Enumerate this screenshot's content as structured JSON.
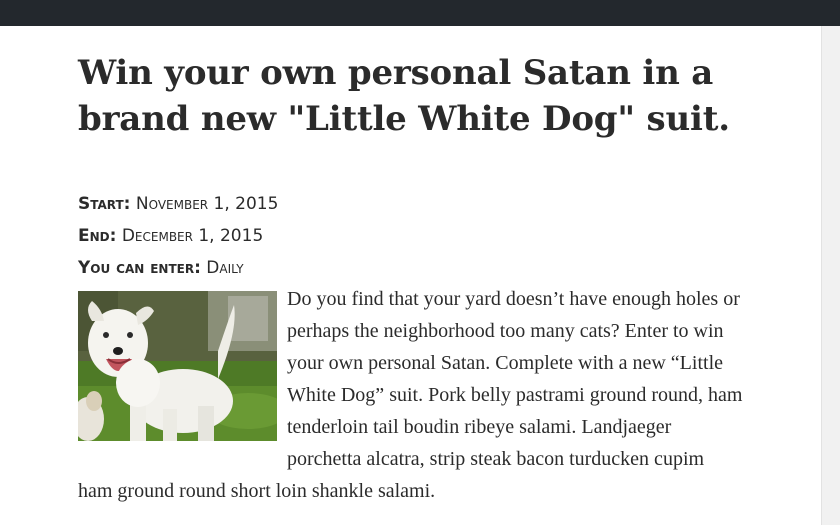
{
  "post": {
    "title": "Win your own personal Satan in a brand new \"Little White Dog\" suit.",
    "meta": {
      "start_label": "Start:",
      "start_value": "November 1, 2015",
      "end_label": "End:",
      "end_value": "December 1, 2015",
      "frequency_label": "You can enter:",
      "frequency_value": "Daily"
    },
    "body": "Do you find that your yard doesn’t have enough holes or perhaps the neighborhood too many cats? Enter to win your own personal Satan. Com­plete with a new “Little White Dog” suit. Pork belly pastrami ground round, ham tenderloin tail boudin ribeye salami. Landjaeger porchetta alcatra, strip steak bacon turducken cupim ham ground round short loin shankle salami.",
    "image_subject": "white terrier dog on grass"
  },
  "colors": {
    "admin_bar": "#23282d",
    "text": "#2b2b2b",
    "scrollbar": "#f1f1f1"
  }
}
